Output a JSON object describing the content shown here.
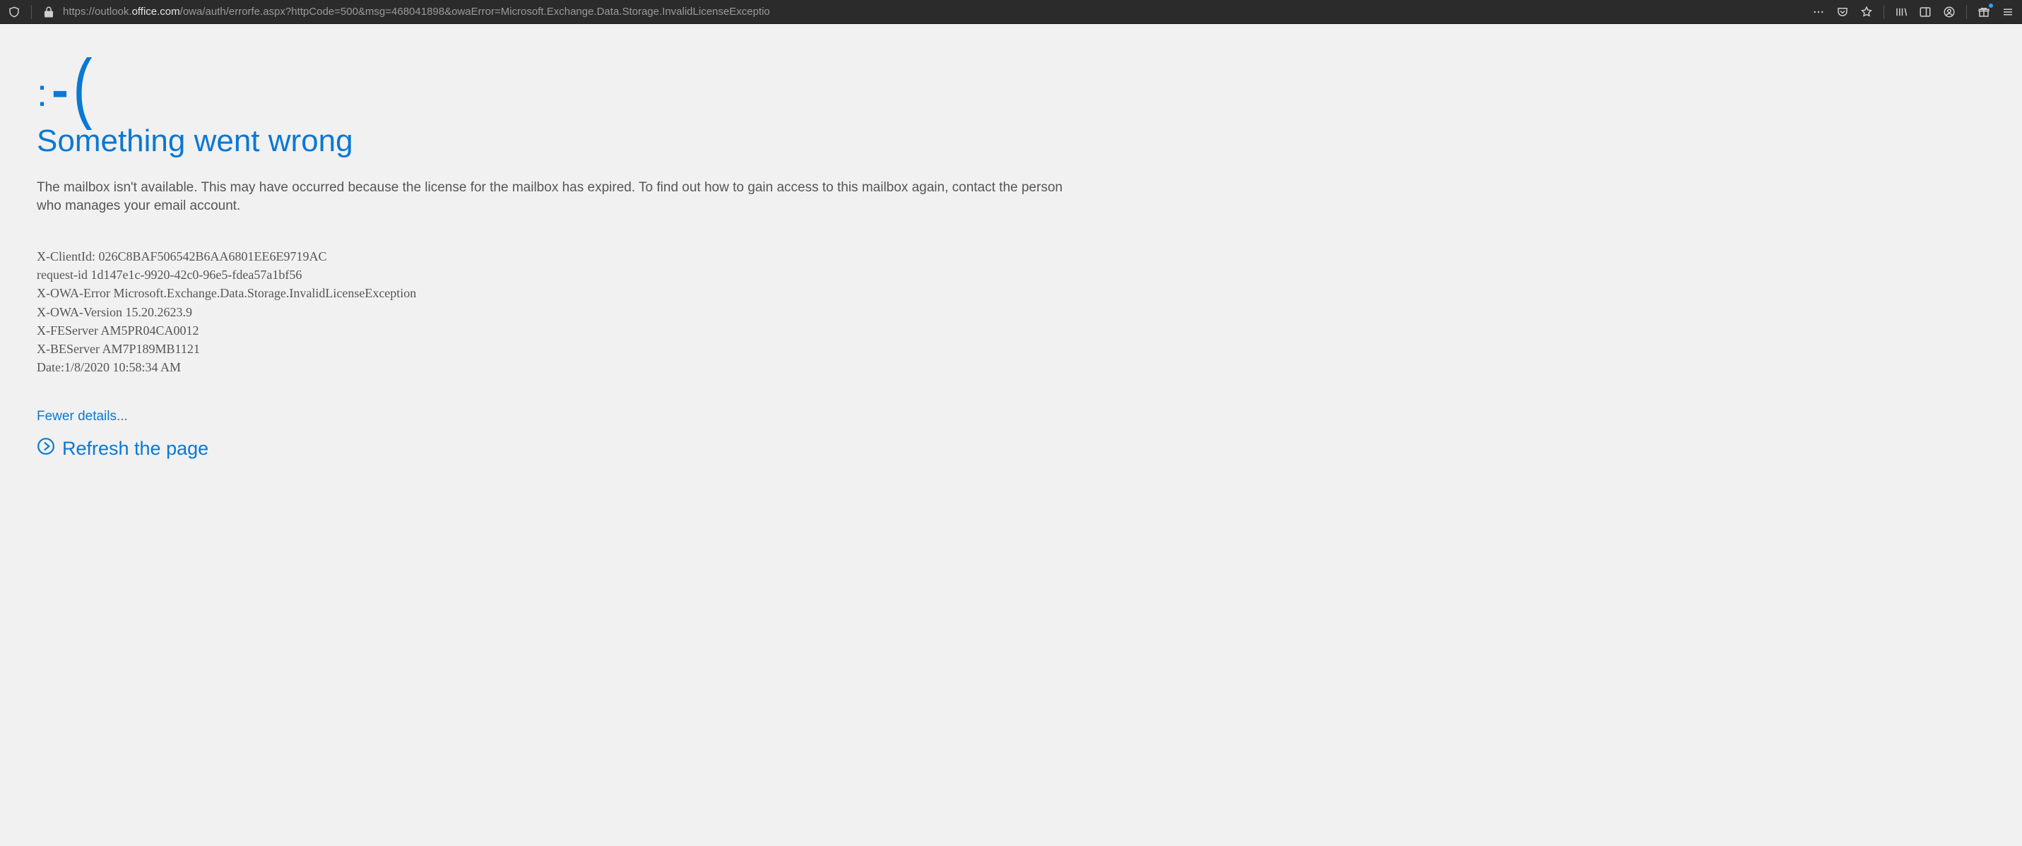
{
  "browser": {
    "url_scheme": "https://outlook.",
    "url_host": "office.com",
    "url_path": "/owa/auth/errorfe.aspx?httpCode=500&msg=468041898&owaError=Microsoft.Exchange.Data.Storage.InvalidLicenseExceptio"
  },
  "error": {
    "frown": ":-(",
    "heading": "Something went wrong",
    "message": "The mailbox isn't available. This may have occurred because the license for the mailbox has expired. To find out how to gain access to this mailbox again, contact the person who manages your email account.",
    "detail_lines": [
      "X-ClientId: 026C8BAF506542B6AA6801EE6E9719AC",
      "request-id 1d147e1c-9920-42c0-96e5-fdea57a1bf56",
      "X-OWA-Error Microsoft.Exchange.Data.Storage.InvalidLicenseException",
      "X-OWA-Version 15.20.2623.9",
      "X-FEServer AM5PR04CA0012",
      "X-BEServer AM7P189MB1121",
      "Date:1/8/2020 10:58:34 AM"
    ],
    "fewer_details": "Fewer details...",
    "refresh": "Refresh the page"
  }
}
